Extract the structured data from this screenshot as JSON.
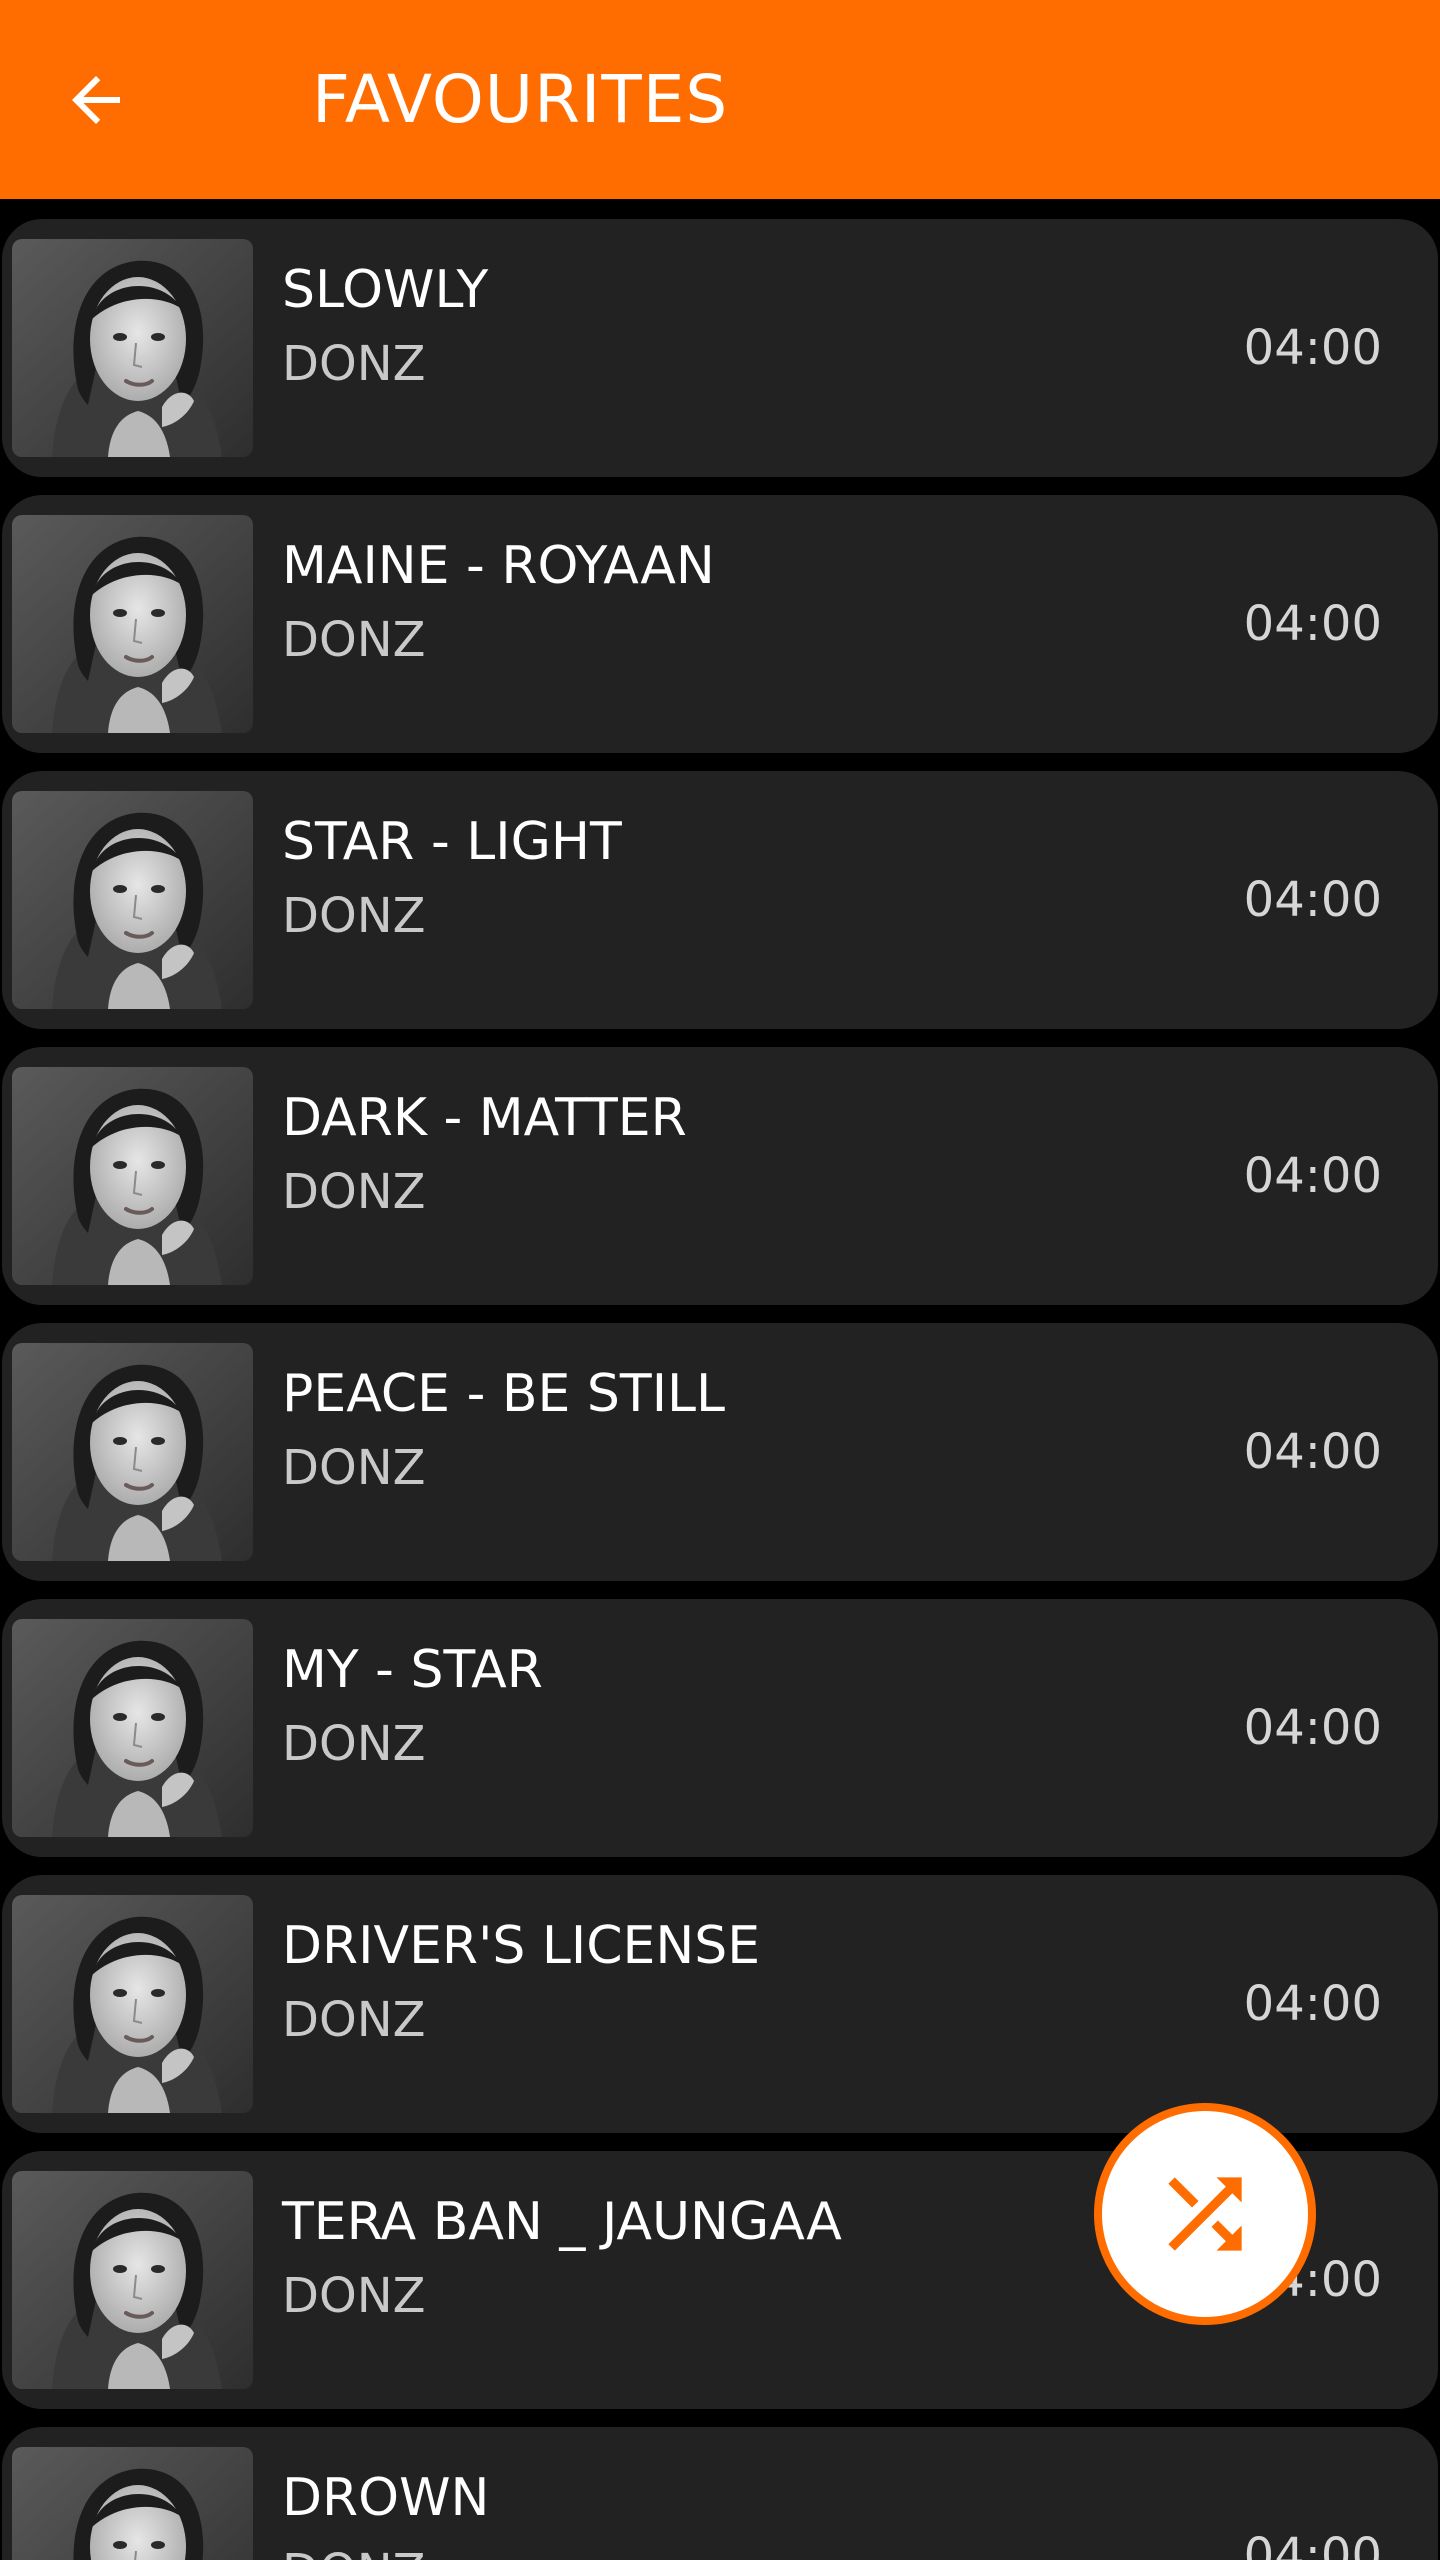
{
  "header": {
    "title": "FAVOURITES",
    "back_icon": "arrow-left-icon"
  },
  "colors": {
    "accent": "#FF6D00",
    "background": "#000000",
    "card": "#222222",
    "title_text": "#FFFFFF",
    "secondary_text": "#C9C9C9"
  },
  "songs": [
    {
      "title": "SLOWLY",
      "artist": "DONZ",
      "duration": "04:00"
    },
    {
      "title": "MAINE - ROYAAN",
      "artist": "DONZ",
      "duration": "04:00"
    },
    {
      "title": "STAR - LIGHT",
      "artist": "DONZ",
      "duration": "04:00"
    },
    {
      "title": "DARK - MATTER",
      "artist": "DONZ",
      "duration": "04:00"
    },
    {
      "title": "PEACE - BE STILL",
      "artist": "DONZ",
      "duration": "04:00"
    },
    {
      "title": "MY - STAR",
      "artist": "DONZ",
      "duration": "04:00"
    },
    {
      "title": "DRIVER'S LICENSE",
      "artist": "DONZ",
      "duration": "04:00"
    },
    {
      "title": "TERA BAN _ JAUNGAA",
      "artist": "DONZ",
      "duration": "04:00"
    },
    {
      "title": "DROWN",
      "artist": "DONZ",
      "duration": "04:00"
    }
  ],
  "fab": {
    "icon": "shuffle-icon"
  }
}
